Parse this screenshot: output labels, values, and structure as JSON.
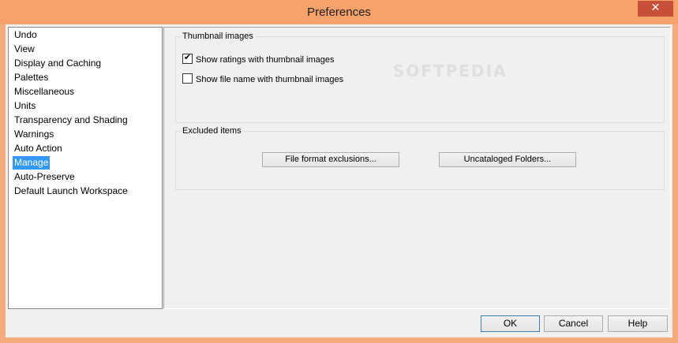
{
  "window": {
    "title": "Preferences",
    "close_glyph": "✕",
    "titlebar_color": "#f7a26b",
    "close_color": "#c7503a"
  },
  "nav": {
    "items": [
      {
        "label": "Undo"
      },
      {
        "label": "View"
      },
      {
        "label": "Display and Caching"
      },
      {
        "label": "Palettes"
      },
      {
        "label": "Miscellaneous"
      },
      {
        "label": "Units"
      },
      {
        "label": "Transparency and Shading"
      },
      {
        "label": "Warnings"
      },
      {
        "label": "Auto Action"
      },
      {
        "label": "Manage",
        "selected": true
      },
      {
        "label": "Auto-Preserve"
      },
      {
        "label": "Default Launch Workspace"
      }
    ],
    "selected_color": "#3399ff"
  },
  "thumbnail_group": {
    "title": "Thumbnail images",
    "options": [
      {
        "label": "Show ratings with thumbnail images",
        "checked": true
      },
      {
        "label": "Show file name with thumbnail images",
        "checked": false
      }
    ]
  },
  "excluded_group": {
    "title": "Excluded items",
    "file_format_button": "File format exclusions...",
    "uncataloged_button": "Uncataloged Folders..."
  },
  "footer": {
    "ok": "OK",
    "cancel": "Cancel",
    "help": "Help"
  },
  "watermark": {
    "text": "SOFTPEDIA"
  }
}
